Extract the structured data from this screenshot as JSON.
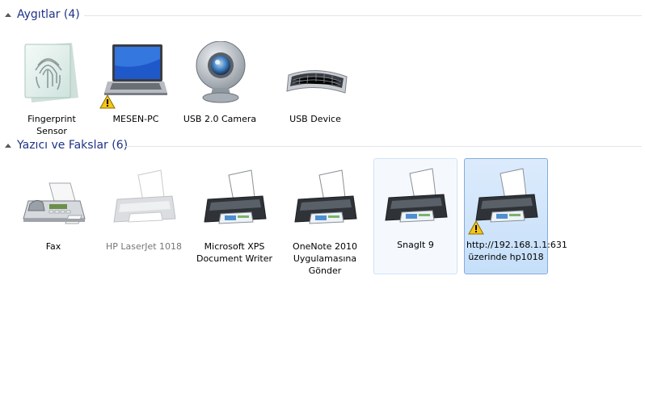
{
  "groups": [
    {
      "title": "Aygıtlar (4)",
      "items": [
        {
          "label": "Fingerprint Sensor",
          "icon": "fingerprint-icon",
          "warning": false
        },
        {
          "label": "MESEN-PC",
          "icon": "laptop-icon",
          "warning": true
        },
        {
          "label": "USB 2.0 Camera",
          "icon": "webcam-icon",
          "warning": false
        },
        {
          "label": "USB Device",
          "icon": "keyboard-icon",
          "warning": false
        }
      ]
    },
    {
      "title": "Yazıcı ve Fakslar (6)",
      "items": [
        {
          "label": "Fax",
          "icon": "fax-icon",
          "warning": false
        },
        {
          "label": "HP LaserJet 1018",
          "icon": "printer-icon",
          "warning": false,
          "state": "disabled"
        },
        {
          "label": "Microsoft XPS Document Writer",
          "icon": "printer-icon",
          "warning": false
        },
        {
          "label": "OneNote 2010 Uygulamasına Gönder",
          "icon": "printer-icon",
          "warning": false
        },
        {
          "label": "SnagIt 9",
          "icon": "printer-icon",
          "warning": false,
          "state": "hover"
        },
        {
          "label": "http://192.168.1.1:631 üzerinde hp1018",
          "icon": "printer-icon",
          "warning": true,
          "state": "selected"
        }
      ]
    }
  ],
  "colors": {
    "header_text": "#1e3287",
    "selection_border": "#84acdd",
    "hover_border": "#cde3f9"
  }
}
